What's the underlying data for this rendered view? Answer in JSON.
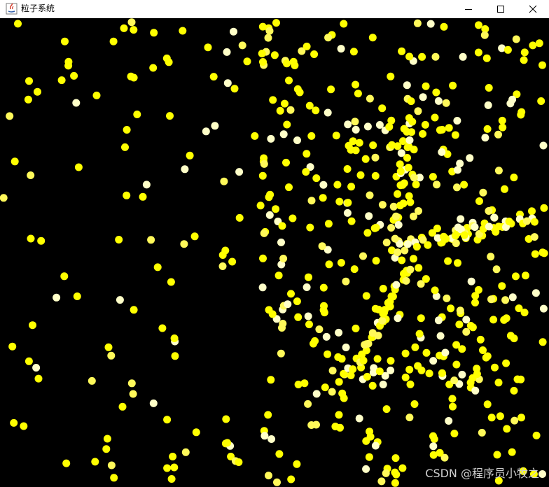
{
  "window": {
    "title": "粒子系统",
    "icon": "java-app-icon",
    "controls": [
      "minimize-icon",
      "maximize-icon",
      "close-icon"
    ]
  },
  "canvas": {
    "background": "#000000",
    "particle_colors": [
      "#ffff00",
      "#fff95a",
      "#ffffc8"
    ],
    "watermark": "CSDN @程序员小牧之"
  }
}
